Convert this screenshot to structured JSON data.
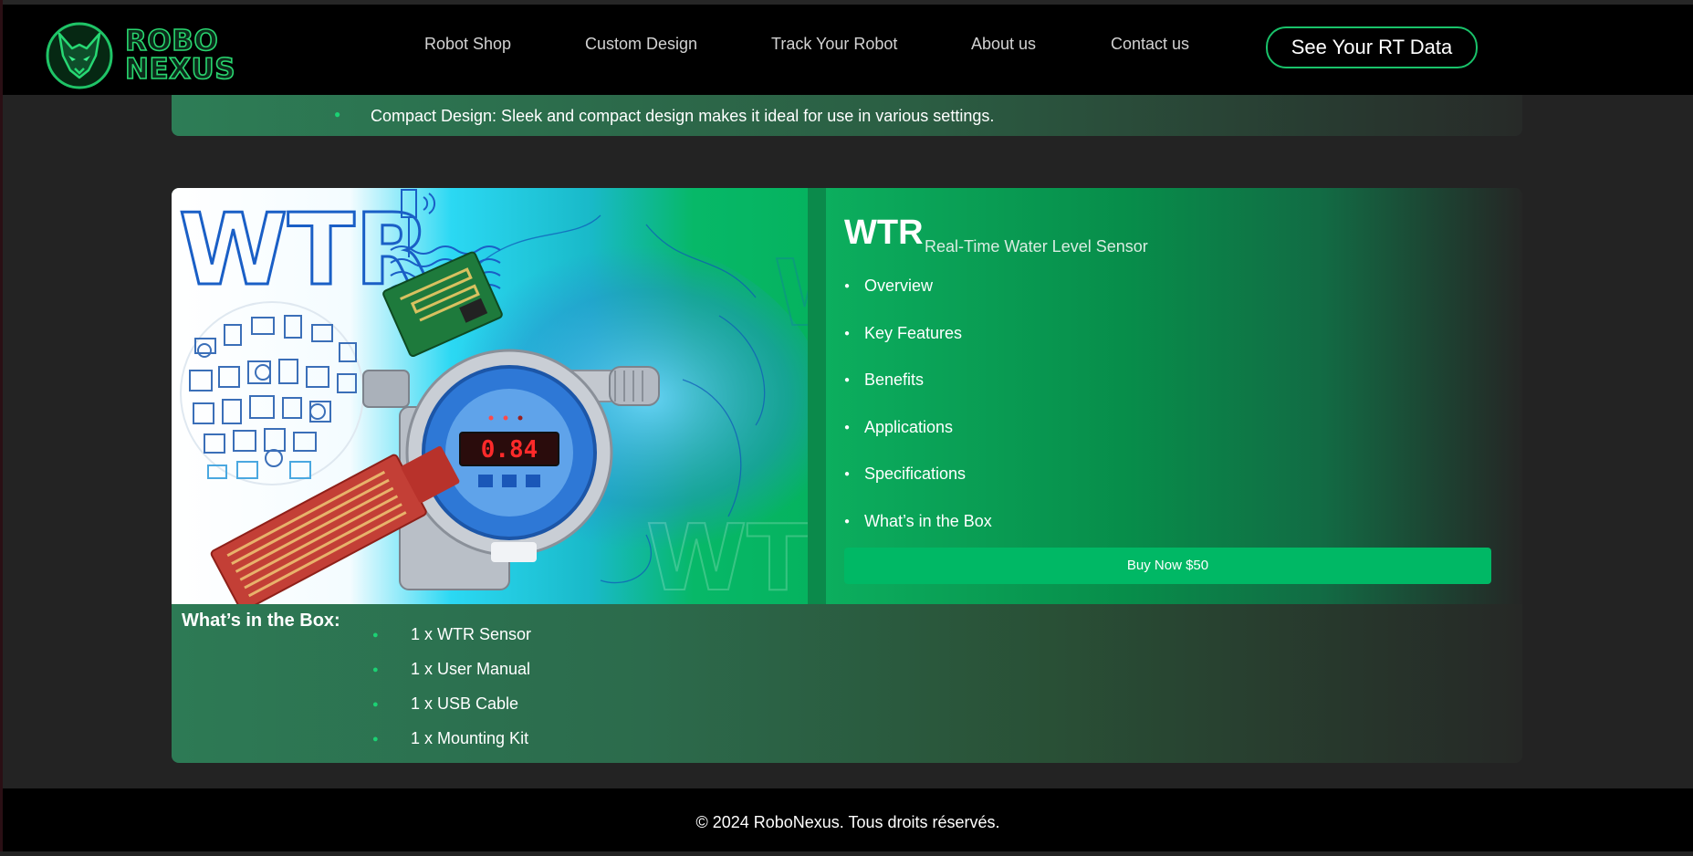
{
  "header": {
    "logo_line1": "ROBO",
    "logo_line2": "NEXUS",
    "nav": [
      "Robot Shop",
      "Custom Design",
      "Track Your Robot",
      "About us",
      "Contact us"
    ],
    "cta_label": "See Your RT Data"
  },
  "previous_card": {
    "last_feature": "Compact Design: Sleek and compact design makes it ideal for use in various settings."
  },
  "product": {
    "image_alt": "WTR water level sensor product image",
    "image_badge": "WTR",
    "display_reading": "0.84",
    "name": "WTR",
    "tagline": "Real-Time Water Level Sensor",
    "sections": [
      "Overview",
      "Key Features",
      "Benefits",
      "Applications",
      "Specifications",
      "What’s in the Box"
    ],
    "buy_label": "Buy Now $50",
    "box_title": "What’s in the Box:",
    "box_items": [
      "1 x WTR Sensor",
      "1 x User Manual",
      "1 x USB Cable",
      "1 x Mounting Kit"
    ]
  },
  "footer": {
    "copyright": "© 2024 RoboNexus. Tous droits réservés."
  },
  "colors": {
    "accent": "#00b865",
    "accent_outline": "#19c26a",
    "bullet": "#1bd273",
    "background": "#232323"
  },
  "icons": [
    "wolf-logo-icon",
    "bullet-icon"
  ]
}
